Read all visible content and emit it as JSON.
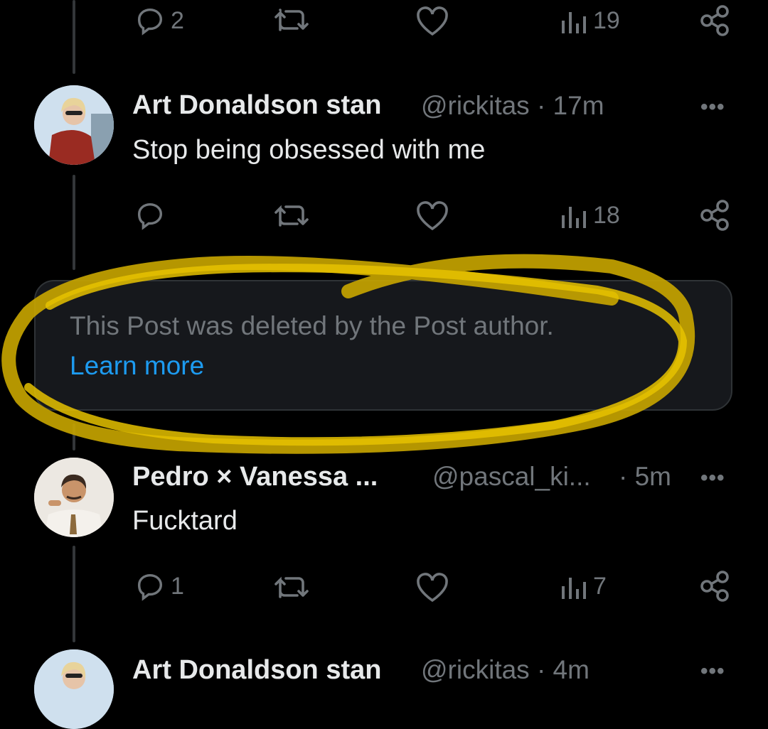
{
  "colors": {
    "background": "#000000",
    "muted": "#71767b",
    "text": "#e7e9ea",
    "link": "#1d9bf0",
    "highlight": "#e6c200"
  },
  "top_actions": {
    "reply_count": "2",
    "views_count": "19"
  },
  "post1": {
    "name": "Art Donaldson stan",
    "handle_time": "@rickitas · 17m",
    "text": "Stop being obsessed with me",
    "more": "•••",
    "views_count": "18"
  },
  "deleted": {
    "message": "This Post was deleted by the Post author.",
    "link": "Learn more"
  },
  "post2": {
    "name": "Pedro × Vanessa ...",
    "handle": "@pascal_ki...",
    "time": "· 5m",
    "text": "Fucktard",
    "more": "•••",
    "reply_count": "1",
    "views_count": "7"
  },
  "post3": {
    "name": "Art Donaldson stan",
    "handle_time": "@rickitas · 4m",
    "more": "•••"
  }
}
